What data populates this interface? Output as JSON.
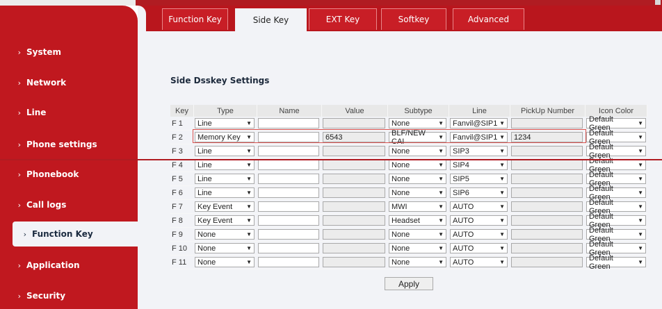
{
  "nav": [
    {
      "label": "System",
      "active": false
    },
    {
      "label": "Network",
      "active": false
    },
    {
      "label": "Line",
      "active": false
    },
    {
      "label": "Phone settings",
      "active": false
    },
    {
      "label": "Phonebook",
      "active": false
    },
    {
      "label": "Call logs",
      "active": false
    },
    {
      "label": "Function Key",
      "active": true
    },
    {
      "label": "Application",
      "active": false
    },
    {
      "label": "Security",
      "active": false
    }
  ],
  "tabs": [
    {
      "label": "Function Key",
      "active": false
    },
    {
      "label": "Side Key",
      "active": true
    },
    {
      "label": "EXT Key",
      "active": false
    },
    {
      "label": "Softkey",
      "active": false
    },
    {
      "label": "Advanced",
      "active": false
    }
  ],
  "section_title": "Side Dsskey Settings",
  "table": {
    "headers": [
      "Key",
      "Type",
      "Name",
      "Value",
      "Subtype",
      "Line",
      "PickUp Number",
      "Icon Color"
    ],
    "rows": [
      {
        "key": "F 1",
        "type": "Line",
        "name": "",
        "value": "",
        "subtype": "None",
        "line": "Fanvil@SIP1",
        "pickup": "",
        "icon_color": "Default Green"
      },
      {
        "key": "F 2",
        "type": "Memory Key",
        "name": "",
        "value": "6543",
        "subtype": "BLF/NEW CAI",
        "line": "Fanvil@SIP1",
        "pickup": "1234",
        "icon_color": "Default Green"
      },
      {
        "key": "F 3",
        "type": "Line",
        "name": "",
        "value": "",
        "subtype": "None",
        "line": "SIP3",
        "pickup": "",
        "icon_color": "Default Green"
      },
      {
        "key": "F 4",
        "type": "Line",
        "name": "",
        "value": "",
        "subtype": "None",
        "line": "SIP4",
        "pickup": "",
        "icon_color": "Default Green"
      },
      {
        "key": "F 5",
        "type": "Line",
        "name": "",
        "value": "",
        "subtype": "None",
        "line": "SIP5",
        "pickup": "",
        "icon_color": "Default Green"
      },
      {
        "key": "F 6",
        "type": "Line",
        "name": "",
        "value": "",
        "subtype": "None",
        "line": "SIP6",
        "pickup": "",
        "icon_color": "Default Green"
      },
      {
        "key": "F 7",
        "type": "Key Event",
        "name": "",
        "value": "",
        "subtype": "MWI",
        "line": "AUTO",
        "pickup": "",
        "icon_color": "Default Green"
      },
      {
        "key": "F 8",
        "type": "Key Event",
        "name": "",
        "value": "",
        "subtype": "Headset",
        "line": "AUTO",
        "pickup": "",
        "icon_color": "Default Green"
      },
      {
        "key": "F 9",
        "type": "None",
        "name": "",
        "value": "",
        "subtype": "None",
        "line": "AUTO",
        "pickup": "",
        "icon_color": "Default Green"
      },
      {
        "key": "F 10",
        "type": "None",
        "name": "",
        "value": "",
        "subtype": "None",
        "line": "AUTO",
        "pickup": "",
        "icon_color": "Default Green"
      },
      {
        "key": "F 11",
        "type": "None",
        "name": "",
        "value": "",
        "subtype": "None",
        "line": "AUTO",
        "pickup": "",
        "icon_color": "Default Green"
      }
    ]
  },
  "apply_label": "Apply",
  "colors": {
    "brand_red": "#c0181f",
    "tab_red": "#b9161d",
    "content_bg": "#f2f3f7",
    "highlight_outline": "#d9534f"
  }
}
